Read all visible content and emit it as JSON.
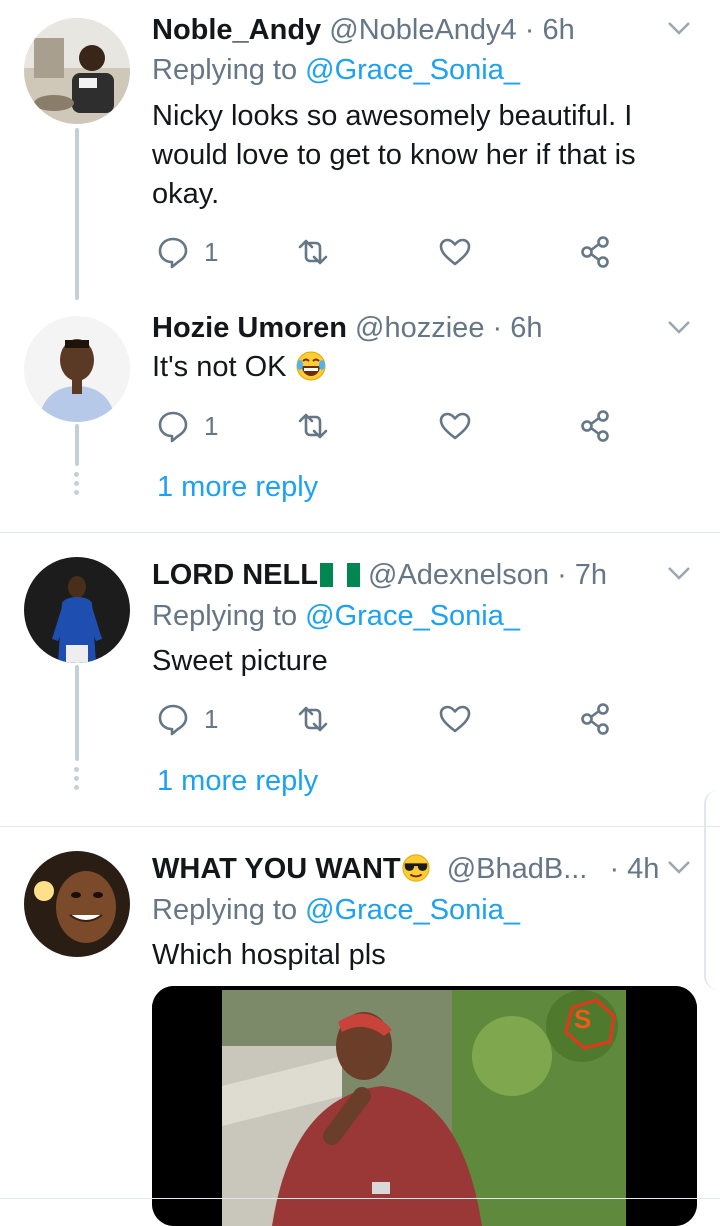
{
  "tweets": [
    {
      "name": "Noble_Andy",
      "handle": "@NobleAndy4",
      "time": "6h",
      "replying_prefix": "Replying to",
      "replying_to": "@Grace_Sonia_",
      "text": "Nicky looks so awesomely beautiful. I would love to get to know her if that is okay.",
      "reply_count": "1"
    },
    {
      "name": "Hozie Umoren",
      "handle": "@hozziee",
      "time": "6h",
      "text": "It's not OK",
      "reply_count": "1",
      "more_reply": "1 more reply"
    },
    {
      "name": "LORD NELL",
      "handle": "@Adexnelson",
      "time": "7h",
      "replying_prefix": "Replying to",
      "replying_to": "@Grace_Sonia_",
      "text": "Sweet picture",
      "reply_count": "1",
      "more_reply": "1 more reply"
    },
    {
      "name": "WHAT YOU WANT",
      "handle": "@BhadB...",
      "time": "4h",
      "replying_prefix": "Replying to",
      "replying_to": "@Grace_Sonia_",
      "text": "Which hospital pls"
    }
  ],
  "icons": {
    "reply": "reply-icon",
    "retweet": "retweet-icon",
    "like": "heart-icon",
    "share": "share-icon",
    "menu": "chevron-down-icon"
  },
  "colors": {
    "link": "#1da1f2",
    "muted": "#657786",
    "thread": "#c4cfd6"
  }
}
